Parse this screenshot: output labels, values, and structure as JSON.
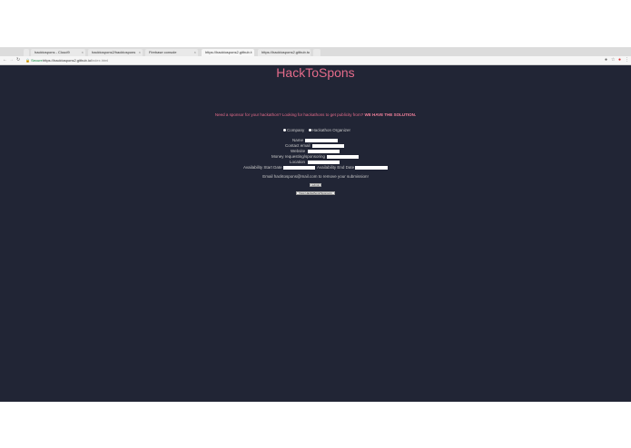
{
  "browser": {
    "tabs": [
      {
        "label": "hacktospons - Cloud9"
      },
      {
        "label": "hacktospons2/hacktospons"
      },
      {
        "label": "Firebase console"
      },
      {
        "label": "https://hacktospons2.github.i"
      },
      {
        "label": "https://hacktospons2.github.io"
      }
    ],
    "secure_label": "Secure",
    "url_host": "https://hacktospons2.github.io/",
    "url_path": "index.html"
  },
  "page": {
    "title": "HackToSpons",
    "tagline_main": "Need a sponsor for your hackathon? Looking for hackathons to get publicity from?",
    "tagline_bold": "WE HAVE THE SOLUTION.",
    "radio_company": "Company",
    "radio_organizer": "Hackathon Organizer",
    "form": {
      "name_label": "Name",
      "email_label": "Contact email",
      "website_label": "Website",
      "money_label": "Money requesting/sponsoring",
      "location_label": "Location",
      "start_label": "Availability Start Date",
      "end_label": "Availability End Date"
    },
    "email_note": "Email hacktospons@mail.com to remove your submission!",
    "submit_label": "submit",
    "view_label": "View Hackathons/Sponsors"
  }
}
